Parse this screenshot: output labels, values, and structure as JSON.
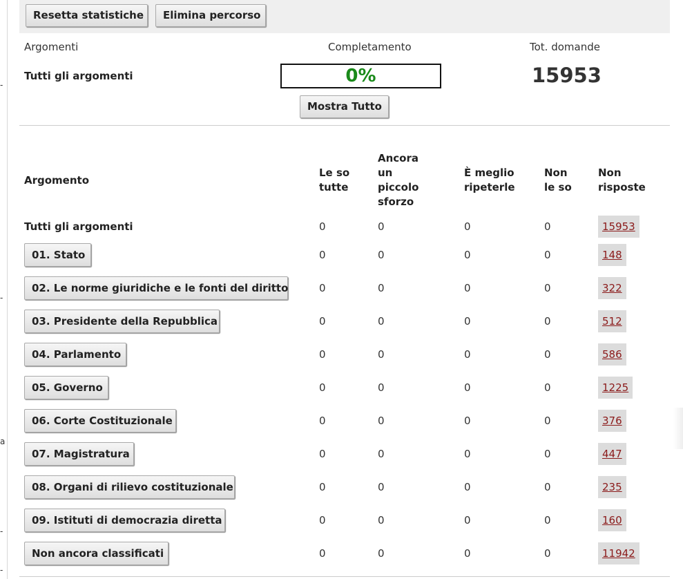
{
  "margin_marks": [
    "-",
    "-",
    "a",
    "-",
    "-"
  ],
  "toolbar": {
    "reset_label": "Resetta statistiche",
    "delete_label": "Elimina percorso"
  },
  "summary": {
    "col_topics": "Argomenti",
    "col_completion": "Completamento",
    "col_total": "Tot. domande",
    "topic_label": "Tutti gli argomenti",
    "completion_percent": 0,
    "completion_text": "0%",
    "total_value": "15953",
    "show_all_label": "Mostra Tutto"
  },
  "table": {
    "headers": {
      "topic": "Argomento",
      "know_all": "Le so tutte",
      "little_effort": "Ancora un piccolo sforzo",
      "better_repeat": "È meglio ripeterle",
      "dont_know": "Non le so",
      "unanswered": "Non risposte"
    },
    "rows": [
      {
        "label": "Tutti gli argomenti",
        "is_button": false,
        "know_all": "0",
        "little_effort": "0",
        "better_repeat": "0",
        "dont_know": "0",
        "unanswered": "15953"
      },
      {
        "label": "01. Stato",
        "is_button": true,
        "know_all": "0",
        "little_effort": "0",
        "better_repeat": "0",
        "dont_know": "0",
        "unanswered": "148"
      },
      {
        "label": "02. Le norme giuridiche e le fonti del diritto",
        "is_button": true,
        "know_all": "0",
        "little_effort": "0",
        "better_repeat": "0",
        "dont_know": "0",
        "unanswered": "322"
      },
      {
        "label": "03. Presidente della Repubblica",
        "is_button": true,
        "know_all": "0",
        "little_effort": "0",
        "better_repeat": "0",
        "dont_know": "0",
        "unanswered": "512"
      },
      {
        "label": "04. Parlamento",
        "is_button": true,
        "know_all": "0",
        "little_effort": "0",
        "better_repeat": "0",
        "dont_know": "0",
        "unanswered": "586"
      },
      {
        "label": "05. Governo",
        "is_button": true,
        "know_all": "0",
        "little_effort": "0",
        "better_repeat": "0",
        "dont_know": "0",
        "unanswered": "1225"
      },
      {
        "label": "06. Corte Costituzionale",
        "is_button": true,
        "know_all": "0",
        "little_effort": "0",
        "better_repeat": "0",
        "dont_know": "0",
        "unanswered": "376"
      },
      {
        "label": "07. Magistratura",
        "is_button": true,
        "know_all": "0",
        "little_effort": "0",
        "better_repeat": "0",
        "dont_know": "0",
        "unanswered": "447"
      },
      {
        "label": "08. Organi di rilievo costituzionale",
        "is_button": true,
        "know_all": "0",
        "little_effort": "0",
        "better_repeat": "0",
        "dont_know": "0",
        "unanswered": "235"
      },
      {
        "label": "09. Istituti di democrazia diretta",
        "is_button": true,
        "know_all": "0",
        "little_effort": "0",
        "better_repeat": "0",
        "dont_know": "0",
        "unanswered": "160"
      },
      {
        "label": "Non ancora classificati",
        "is_button": true,
        "know_all": "0",
        "little_effort": "0",
        "better_repeat": "0",
        "dont_know": "0",
        "unanswered": "11942"
      }
    ]
  }
}
